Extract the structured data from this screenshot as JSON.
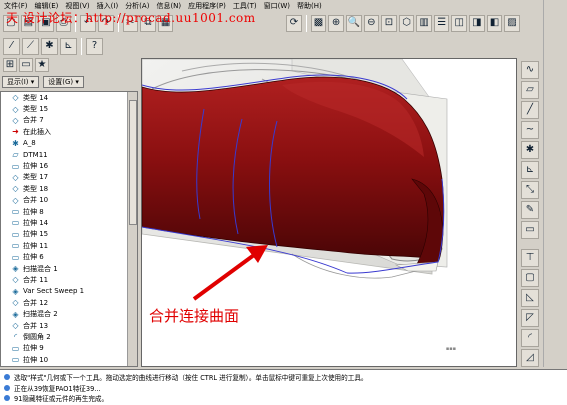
{
  "menu": [
    "文件(F)",
    "编辑(E)",
    "视图(V)",
    "插入(I)",
    "分析(A)",
    "信息(N)",
    "应用程序(P)",
    "工具(T)",
    "窗口(W)",
    "帮助(H)"
  ],
  "watermark": "天    设计论坛：http://procad.uu1001.com",
  "toolbar1_icons": [
    "new-icon",
    "open-icon",
    "save-icon",
    "print-icon",
    "undo-icon",
    "redo-icon",
    "cut-icon",
    "copy-icon",
    "paste-icon"
  ],
  "toolbar2_icons": [
    "repaint-icon",
    "zoom-in-icon",
    "zoom-out-icon",
    "refit-icon",
    "orient-icon",
    "saved-views-icon",
    "layers-icon",
    "display-style-icon"
  ],
  "tree_tabs": {
    "show": "显示(I) ▾",
    "settings": "设置(G) ▾"
  },
  "tree_items": [
    {
      "label": "类型 14",
      "icon": "◇"
    },
    {
      "label": "类型 15",
      "icon": "◇"
    },
    {
      "label": "合并 7",
      "icon": "◇"
    },
    {
      "label": "在此插入",
      "icon": "➜",
      "red": true
    },
    {
      "label": "A_8",
      "icon": "✱"
    },
    {
      "label": "DTM11",
      "icon": "▱"
    },
    {
      "label": "拉伸 16",
      "icon": "▭"
    },
    {
      "label": "类型 17",
      "icon": "◇"
    },
    {
      "label": "类型 18",
      "icon": "◇"
    },
    {
      "label": "合并 10",
      "icon": "◇"
    },
    {
      "label": "拉伸 8",
      "icon": "▭"
    },
    {
      "label": "拉伸 14",
      "icon": "▭"
    },
    {
      "label": "拉伸 15",
      "icon": "▭"
    },
    {
      "label": "拉伸 11",
      "icon": "▭"
    },
    {
      "label": "拉伸 6",
      "icon": "▭"
    },
    {
      "label": "扫描混合 1",
      "icon": "◈"
    },
    {
      "label": "合并 11",
      "icon": "◇"
    },
    {
      "label": "Var Sect Sweep 1",
      "icon": "◈"
    },
    {
      "label": "合并 12",
      "icon": "◇"
    },
    {
      "label": "扫描混合 2",
      "icon": "◈"
    },
    {
      "label": "合并 13",
      "icon": "◇"
    },
    {
      "label": "倒圆角 2",
      "icon": "◜"
    },
    {
      "label": "拉伸 9",
      "icon": "▭"
    },
    {
      "label": "拉伸 10",
      "icon": "▭"
    }
  ],
  "annotation": "合并连接曲面",
  "right_toolbar_icons": [
    "sketch-icon",
    "plane-icon",
    "axis-icon",
    "curve-icon",
    "point-icon",
    "csys-icon",
    "analysis-icon",
    "sketch-tool-icon",
    "extrude-icon",
    "revolve-icon",
    "hole-icon",
    "shell-icon",
    "rib-icon",
    "draft-icon",
    "round-icon",
    "chamfer-icon"
  ],
  "messages": [
    "选取\"样式\"几何或下一个工具。拖动选定的曲线进行移动（按住 CTRL 进行复制）。单击鼠标中键可重复上次使用的工具。",
    "正在从39恢复PAO1特征39...",
    "91隐藏特征或元件的再生完成。"
  ],
  "colors": {
    "surface": "#8a0f10",
    "curve": "#3a3ad0",
    "annotation": "#e00000"
  }
}
